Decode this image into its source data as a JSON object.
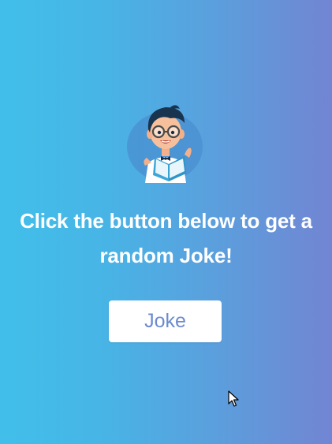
{
  "headline": {
    "line1": "Click the button below to get a",
    "line2": "random Joke!"
  },
  "button": {
    "label": "Joke"
  },
  "icons": {
    "avatar": "boy-reading-book-icon",
    "cursor": "mouse-pointer-icon"
  },
  "colors": {
    "gradient_start": "#41bfea",
    "gradient_end": "#7285d3",
    "button_text": "#6d8ad0",
    "headline_text": "#ffffff"
  }
}
